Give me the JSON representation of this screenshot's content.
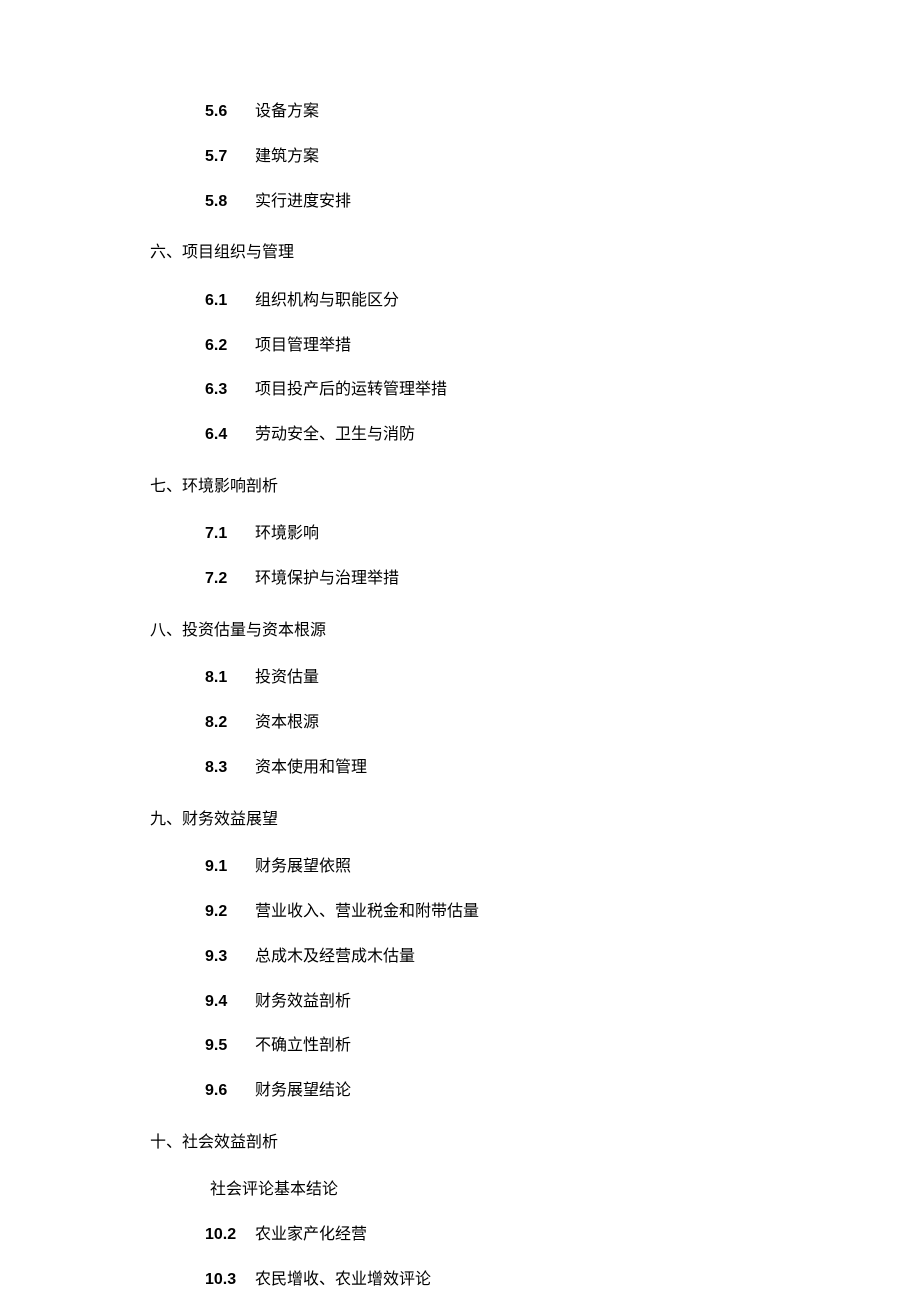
{
  "toc": [
    {
      "heading": null,
      "items": [
        {
          "num": "5.6",
          "text": "设备方案"
        },
        {
          "num": "5.7",
          "text": "建筑方案"
        },
        {
          "num": "5.8",
          "text": "实行进度安排"
        }
      ]
    },
    {
      "heading": "六、项目组织与管理",
      "items": [
        {
          "num": "6.1",
          "text": "组织机构与职能区分"
        },
        {
          "num": "6.2",
          "text": "项目管理举措"
        },
        {
          "num": "6.3",
          "text": "项目投产后的运转管理举措"
        },
        {
          "num": "6.4",
          "text": "劳动安全、卫生与消防"
        }
      ]
    },
    {
      "heading": "七、环境影响剖析",
      "items": [
        {
          "num": "7.1",
          "text": "环境影响"
        },
        {
          "num": "7.2",
          "text": "环境保护与治理举措"
        }
      ]
    },
    {
      "heading": "八、投资估量与资本根源",
      "items": [
        {
          "num": "8.1",
          "text": "投资估量"
        },
        {
          "num": "8.2",
          "text": "资本根源"
        },
        {
          "num": "8.3",
          "text": "资本使用和管理"
        }
      ]
    },
    {
      "heading": "九、财务效益展望",
      "items": [
        {
          "num": "9.1",
          "text": "财务展望依照"
        },
        {
          "num": "9.2",
          "text": "营业收入、营业税金和附带估量"
        },
        {
          "num": "9.3",
          "text": "总成木及经营成木估量"
        },
        {
          "num": "9.4",
          "text": "财务效益剖析"
        },
        {
          "num": "9.5",
          "text": "不确立性剖析"
        },
        {
          "num": "9.6",
          "text": "财务展望结论"
        }
      ]
    },
    {
      "heading": "十、社会效益剖析",
      "items": [
        {
          "num": "",
          "text": "社会评论基本结论"
        },
        {
          "num": "10.2",
          "text": "农业家产化经营"
        },
        {
          "num": "10.3",
          "text": "农民增收、农业增效评论"
        }
      ]
    }
  ]
}
